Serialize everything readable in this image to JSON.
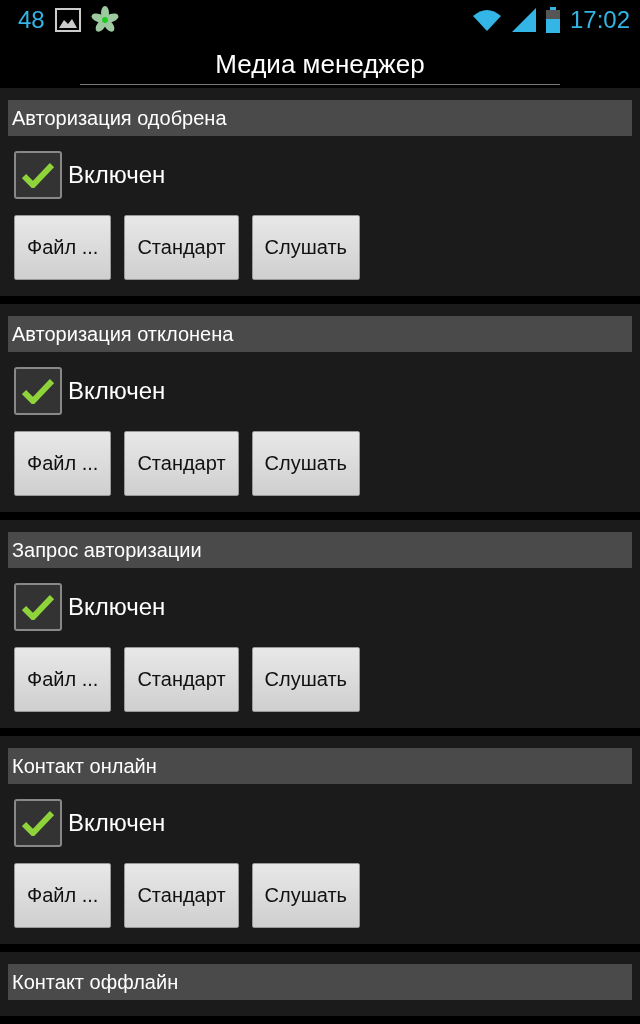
{
  "status_bar": {
    "notification_count": "48",
    "time": "17:02"
  },
  "title": "Медиа менеджер",
  "sections": [
    {
      "title": "Авторизация одобрена",
      "enabled": {
        "label": "Включен",
        "checked": true
      },
      "buttons": [
        "Файл ...",
        "Стандарт",
        "Слушать"
      ]
    },
    {
      "title": "Авторизация отклонена",
      "enabled": {
        "label": "Включен",
        "checked": true
      },
      "buttons": [
        "Файл ...",
        "Стандарт",
        "Слушать"
      ]
    },
    {
      "title": "Запрос авторизации",
      "enabled": {
        "label": "Включен",
        "checked": true
      },
      "buttons": [
        "Файл ...",
        "Стандарт",
        "Слушать"
      ]
    },
    {
      "title": "Контакт онлайн",
      "enabled": {
        "label": "Включен",
        "checked": true
      },
      "buttons": [
        "Файл ...",
        "Стандарт",
        "Слушать"
      ]
    },
    {
      "title": "Контакт оффлайн"
    }
  ]
}
